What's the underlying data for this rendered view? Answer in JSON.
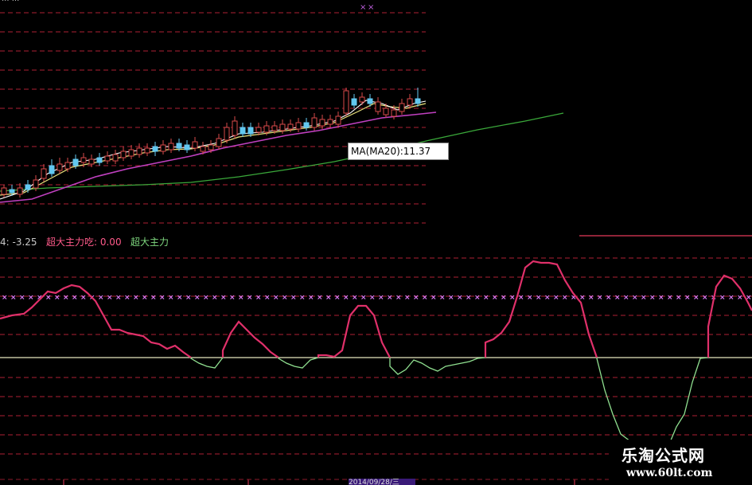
{
  "top_indicator_partial": "... ...",
  "tooltip": {
    "text": "MA(MA20):11.37"
  },
  "indicator_label": {
    "prefix": "4: -3.25",
    "series1": "超大主力吃: 0.00",
    "series2": "超大主力"
  },
  "date_box": "2014/09/28/三",
  "watermark": {
    "title": "乐淘公式网",
    "url": "www.60lt.com"
  },
  "colors": {
    "background": "#000000",
    "grid": "#8b1a2a",
    "candle_up": "#d94a4a",
    "candle_down": "#62c8f0",
    "ma5": "#ffffff",
    "ma10": "#e8e07a",
    "ma20": "#c040c0",
    "ma60": "#3aa83a",
    "indicator_pos": "#e0306a",
    "indicator_neg": "#90e090",
    "zero_line": "#e8e8c0",
    "level_marker": "#e080ff"
  },
  "chart_data": {
    "type": "line",
    "series": [
      {
        "name": "超大主力吃",
        "values": [
          0.0
        ]
      }
    ]
  }
}
